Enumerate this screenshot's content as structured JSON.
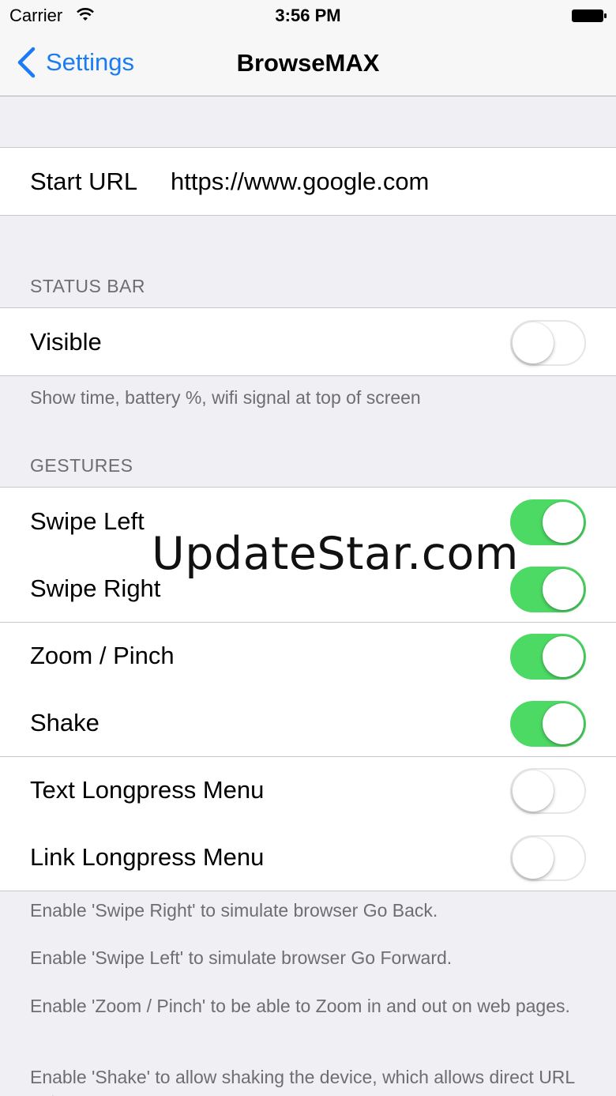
{
  "status_bar": {
    "carrier": "Carrier",
    "time": "3:56 PM"
  },
  "nav": {
    "back_label": "Settings",
    "title": "BrowseMAX"
  },
  "start_url": {
    "label": "Start URL",
    "value": "https://www.google.com"
  },
  "status_bar_section": {
    "header": "STATUS BAR",
    "visible": {
      "label": "Visible",
      "on": false
    },
    "footer": "Show time, battery %, wifi signal at top of screen"
  },
  "gestures": {
    "header": "GESTURES",
    "items": [
      {
        "label": "Swipe Left",
        "on": true
      },
      {
        "label": "Swipe Right",
        "on": true
      },
      {
        "label": "Zoom / Pinch",
        "on": true
      },
      {
        "label": "Shake",
        "on": true
      },
      {
        "label": "Text Longpress Menu",
        "on": false
      },
      {
        "label": "Link Longpress Menu",
        "on": false
      }
    ],
    "footer": [
      "Enable 'Swipe Right' to simulate browser Go Back.",
      "Enable 'Swipe Left' to simulate browser Go Forward.",
      "Enable 'Zoom / Pinch' to be able to Zoom in and out on web pages.",
      "Enable 'Shake' to allow shaking the device, which allows direct URL entry."
    ]
  },
  "watermark": "UpdateStar.com",
  "colors": {
    "accent": "#1a7bf5",
    "switch_on": "#4cd964",
    "background": "#efeff4"
  }
}
